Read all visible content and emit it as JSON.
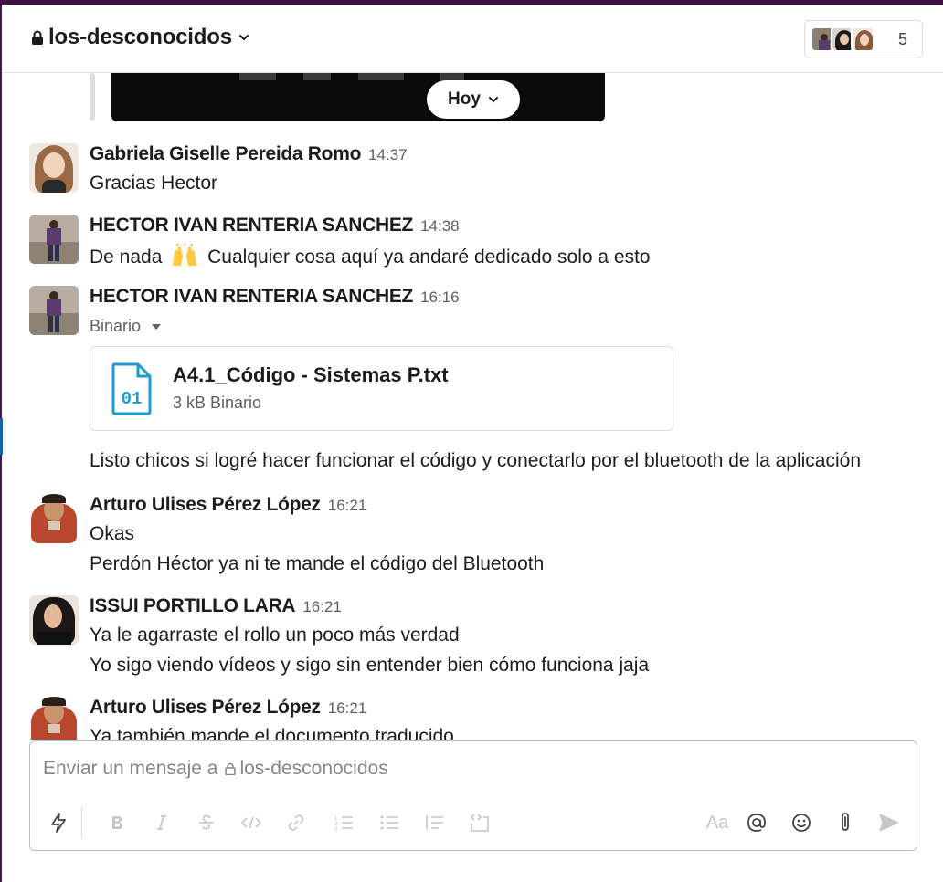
{
  "channel": {
    "name": "los-desconocidos",
    "member_count": "5"
  },
  "date_divider": "Hoy",
  "messages": [
    {
      "sender": "Gabriela Giselle Pereida Romo",
      "time": "14:37",
      "lines": [
        "Gracias Hector"
      ]
    },
    {
      "sender": "HECTOR IVAN RENTERIA SANCHEZ",
      "time": "14:38",
      "text_before_emoji": "De nada",
      "emoji": "raising-hands",
      "text_after_emoji": "Cualquier cosa aquí ya andaré dedicado solo a esto"
    },
    {
      "sender": "HECTOR IVAN RENTERIA SANCHEZ",
      "time": "16:16",
      "file_meta": "Binario",
      "file": {
        "name": "A4.1_Código - Sistemas P.txt",
        "size_type": "3 kB Binario",
        "icon_text": "01"
      },
      "lines": [
        "Listo chicos si logré hacer funcionar el código y conectarlo por el bluetooth de la aplicación"
      ]
    },
    {
      "sender": "Arturo Ulises Pérez López",
      "time": "16:21",
      "lines": [
        "Okas",
        "Perdón Héctor ya ni te mande el código del Bluetooth"
      ]
    },
    {
      "sender": "ISSUI PORTILLO LARA",
      "time": "16:21",
      "lines": [
        "Ya le agarraste el rollo un poco más verdad",
        "Yo sigo viendo vídeos y sigo sin entender bien cómo funciona jaja"
      ]
    },
    {
      "sender": "Arturo Ulises Pérez López",
      "time": "16:21",
      "lines": [
        "Ya también mande el documento traducido"
      ]
    }
  ],
  "composer": {
    "placeholder_prefix": "Enviar un mensaje a",
    "placeholder_channel": "los-desconocidos",
    "format_label": "Aa",
    "tools": [
      "lightning-icon",
      "bold-icon",
      "italic-icon",
      "strikethrough-icon",
      "code-icon",
      "link-icon",
      "ordered-list-icon",
      "bulleted-list-icon",
      "blockquote-icon",
      "code-block-icon",
      "format-toggle",
      "mention-icon",
      "emoji-icon",
      "attach-icon",
      "send-icon"
    ]
  },
  "colors": {
    "workspace": "#3f0e40",
    "file_icon": "#1d9bd1",
    "text": "#1d1c1d",
    "muted": "#616061"
  }
}
